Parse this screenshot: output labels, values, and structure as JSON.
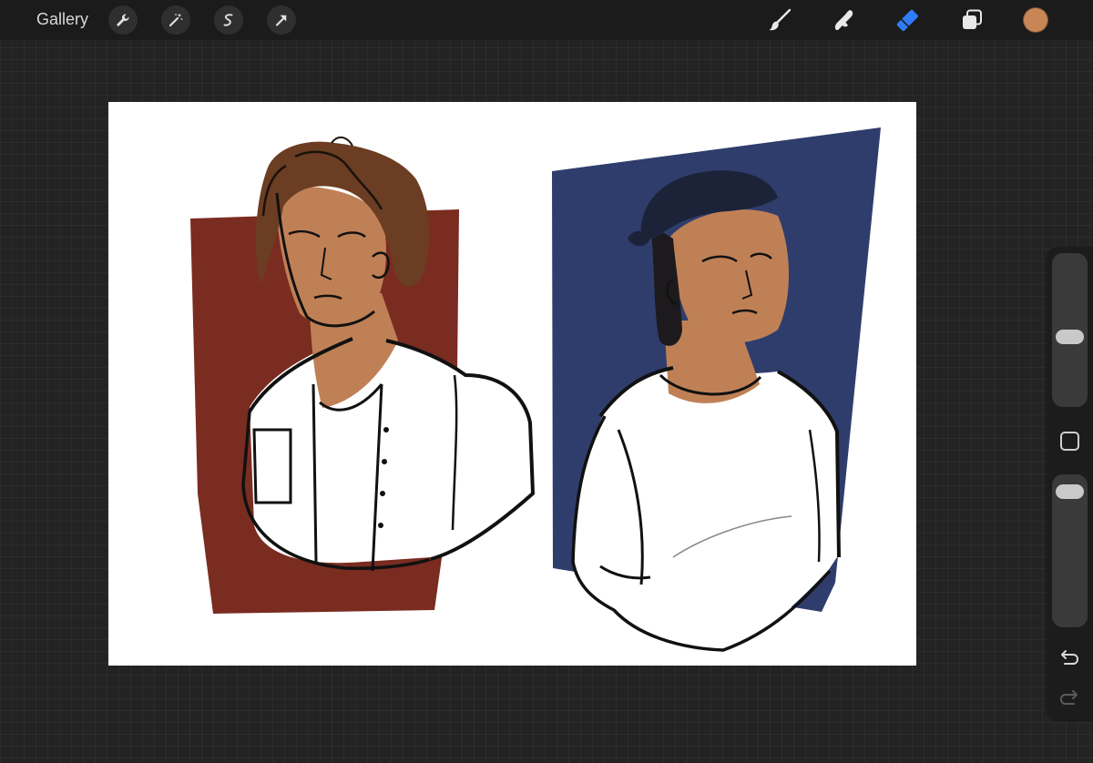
{
  "toolbar": {
    "gallery_label": "Gallery",
    "left_tools": [
      "wrench-icon",
      "magic-wand-icon",
      "selection-icon",
      "transform-arrow-icon"
    ],
    "right_tools": [
      "brush-icon",
      "smudge-icon",
      "eraser-icon",
      "layers-icon"
    ],
    "active_tool": "eraser-icon",
    "current_color": "#c88657",
    "accent_color": "#2f7cf6"
  },
  "sidebar": {
    "brush_size_level": 0.45,
    "opacity_level": 0.05,
    "buttons": [
      "modify-square-icon",
      "undo-icon",
      "redo-icon"
    ]
  },
  "artwork": {
    "left_background": "#7a2c21",
    "right_background": "#2f3d6c",
    "skin": "#c08056",
    "hair": "#6b3d22",
    "bandana": "#1c2238"
  }
}
